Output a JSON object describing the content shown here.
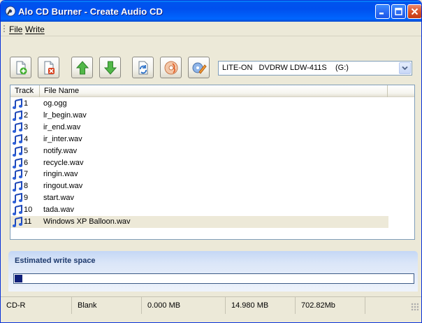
{
  "window": {
    "title": "Alo CD Burner  -  Create Audio CD"
  },
  "menu": {
    "items": [
      "File",
      "Write"
    ]
  },
  "toolbar": {
    "buttons": [
      "add-file",
      "remove-file",
      "move-up",
      "move-down",
      "refresh",
      "burn",
      "erase"
    ],
    "drive": {
      "selected": "LITE-ON   DVDRW LDW-411S    (G:)"
    }
  },
  "list": {
    "columns": [
      "Track",
      "File Name"
    ],
    "rows": [
      {
        "track": "1",
        "name": "og.ogg"
      },
      {
        "track": "2",
        "name": "lr_begin.wav"
      },
      {
        "track": "3",
        "name": "ir_end.wav"
      },
      {
        "track": "4",
        "name": "ir_inter.wav"
      },
      {
        "track": "5",
        "name": "notify.wav"
      },
      {
        "track": "6",
        "name": "recycle.wav"
      },
      {
        "track": "7",
        "name": "ringin.wav"
      },
      {
        "track": "8",
        "name": "ringout.wav"
      },
      {
        "track": "9",
        "name": "start.wav"
      },
      {
        "track": "10",
        "name": "tada.wav"
      },
      {
        "track": "11",
        "name": "Windows XP Balloon.wav"
      }
    ],
    "selected_index": 10
  },
  "space_panel": {
    "title": "Estimated write space",
    "progress_fraction": 0.019
  },
  "status": {
    "media": "CD-R",
    "state": "Blank",
    "used": "0.000 MB",
    "total_used": "14.980 MB",
    "capacity": "702.82Mb",
    "extra": ""
  },
  "colors": {
    "titlebar": "#0054e3",
    "progress": "#10207a",
    "selection": "#ede9d8"
  }
}
